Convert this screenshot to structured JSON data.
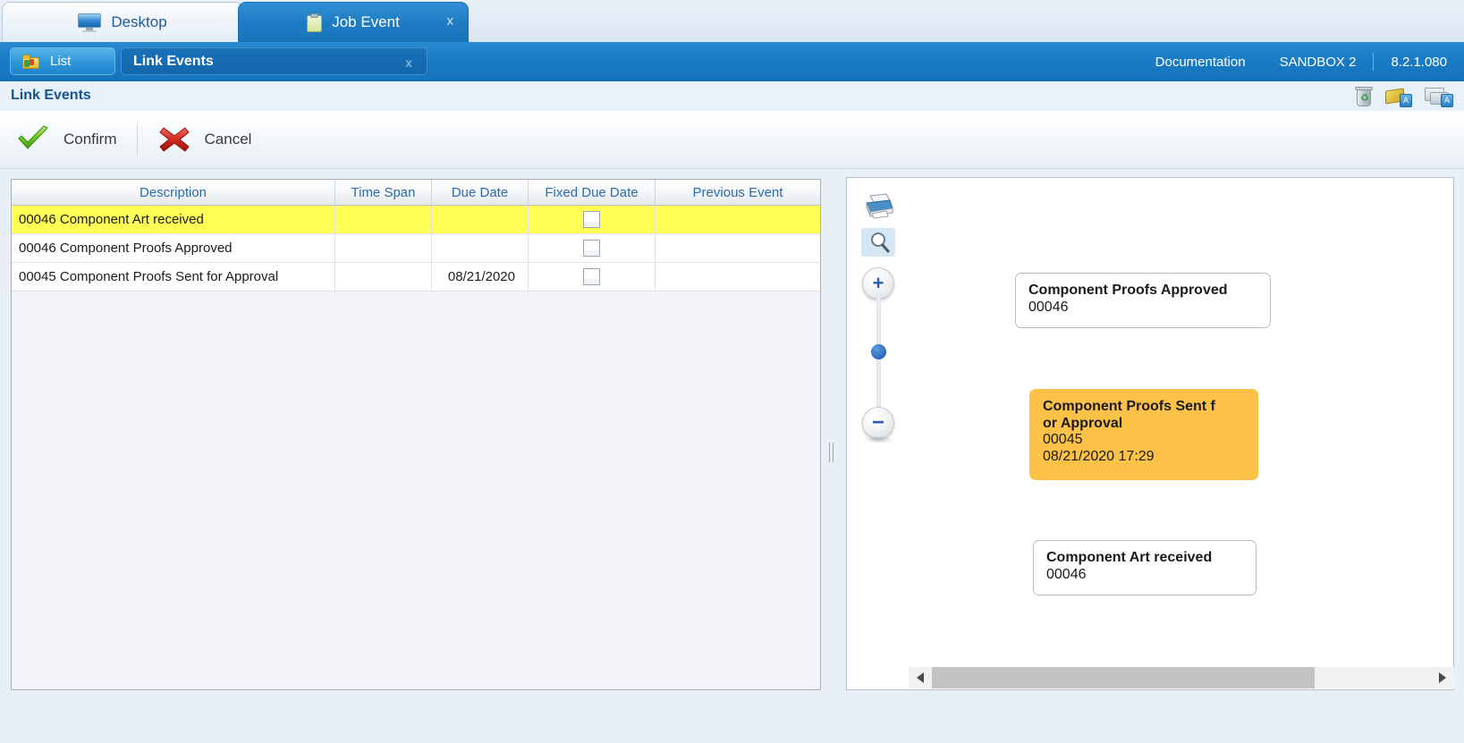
{
  "tabs": [
    {
      "label": "Desktop",
      "icon": "monitor-icon",
      "active": false,
      "close": ""
    },
    {
      "label": "Job Event",
      "icon": "clipboard-icon",
      "active": true,
      "close": "x"
    }
  ],
  "bluebar": {
    "list_button": "List",
    "subtab_label": "Link Events",
    "subtab_close": "x",
    "documentation": "Documentation",
    "environment": "SANDBOX 2",
    "version": "8.2.1.080"
  },
  "page": {
    "title": "Link Events"
  },
  "toolbar": {
    "confirm_label": "Confirm",
    "cancel_label": "Cancel"
  },
  "grid": {
    "columns": [
      "Description",
      "Time Span",
      "Due Date",
      "Fixed Due Date",
      "Previous Event"
    ],
    "rows": [
      {
        "description": "00046 Component Art received",
        "time_span": "",
        "due_date": "",
        "fixed_due_date": false,
        "previous_event": "",
        "selected": true
      },
      {
        "description": "00046 Component Proofs Approved",
        "time_span": "",
        "due_date": "",
        "fixed_due_date": false,
        "previous_event": "",
        "selected": false
      },
      {
        "description": "00045 Component Proofs Sent for Approval",
        "time_span": "",
        "due_date": "08/21/2020",
        "fixed_due_date": false,
        "previous_event": "",
        "selected": false
      }
    ]
  },
  "diagram": {
    "controls": {
      "print_icon": "printer-icon",
      "search_icon": "magnifier-icon",
      "zoom_in": "+",
      "zoom_out": "−"
    },
    "nodes": [
      {
        "title": "Component Proofs Approved",
        "code": "00046",
        "timestamp": "",
        "highlighted": false
      },
      {
        "title": "Component Proofs Sent f\nor Approval",
        "code": "00045",
        "timestamp": "08/21/2020 17:29",
        "highlighted": true
      },
      {
        "title": "Component Art received",
        "code": "00046",
        "timestamp": "",
        "highlighted": false
      }
    ],
    "scrollbar": {
      "left_arrow": "◀",
      "right_arrow": "▶"
    }
  },
  "colors": {
    "accent_blue": "#1a7cc6",
    "selection_yellow": "#ffff55",
    "node_highlight": "#fcc247",
    "header_text": "#2b6cad"
  }
}
